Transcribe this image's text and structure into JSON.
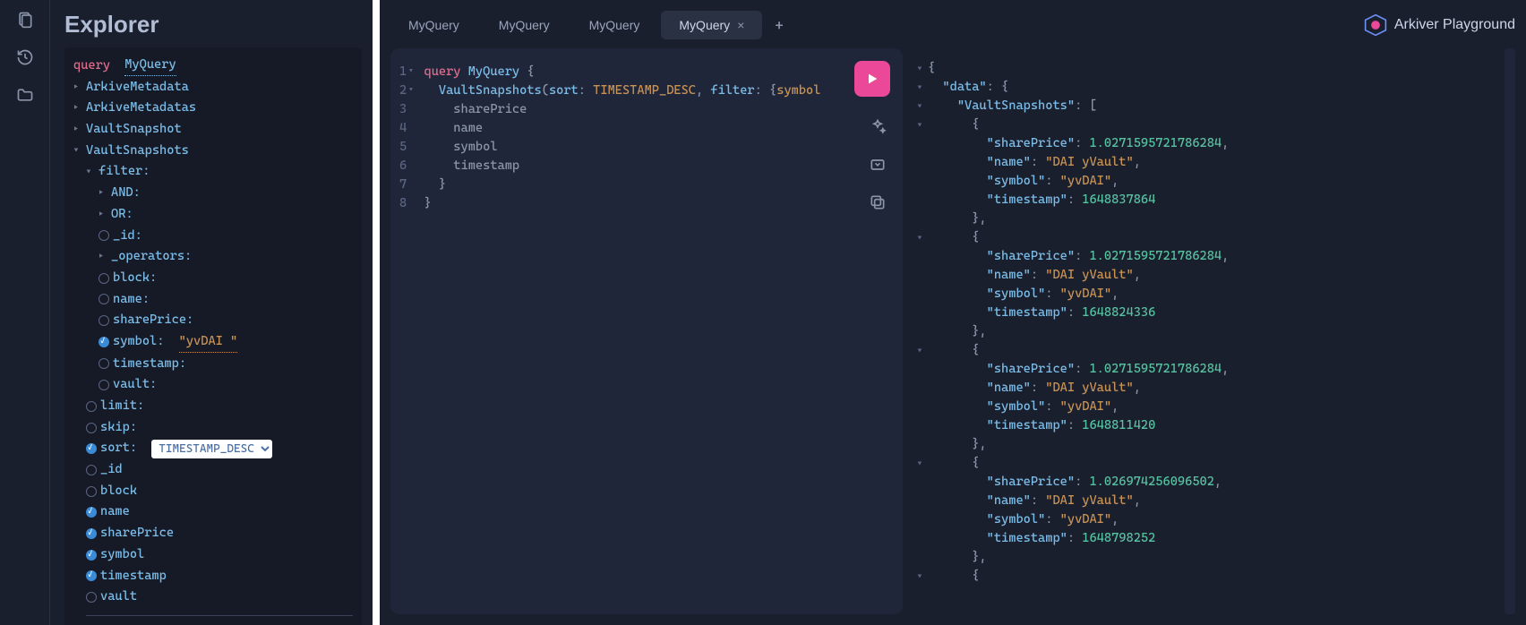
{
  "rail": {
    "icons": [
      "docs-icon",
      "history-icon",
      "folder-icon"
    ]
  },
  "explorer": {
    "title": "Explorer",
    "query_kw": "query",
    "query_name": "MyQuery",
    "types": [
      {
        "name": "ArkiveMetadata",
        "expanded": false
      },
      {
        "name": "ArkiveMetadatas",
        "expanded": false
      },
      {
        "name": "VaultSnapshot",
        "expanded": false
      },
      {
        "name": "VaultSnapshots",
        "expanded": true
      }
    ],
    "vaultSnapshots": {
      "filter": {
        "label": "filter:",
        "children": [
          {
            "kind": "caret",
            "label": "AND:"
          },
          {
            "kind": "caret",
            "label": "OR:"
          },
          {
            "kind": "radio",
            "label": "_id:"
          },
          {
            "kind": "caret",
            "label": "_operators:"
          },
          {
            "kind": "radio",
            "label": "block:"
          },
          {
            "kind": "radio",
            "label": "name:"
          },
          {
            "kind": "radio",
            "label": "sharePrice:"
          },
          {
            "kind": "check",
            "label": "symbol:",
            "value": "\"yvDAI \""
          },
          {
            "kind": "radio",
            "label": "timestamp:"
          },
          {
            "kind": "radio",
            "label": "vault:"
          }
        ]
      },
      "args": [
        {
          "kind": "radio",
          "label": "limit:"
        },
        {
          "kind": "radio",
          "label": "skip:"
        },
        {
          "kind": "check",
          "label": "sort:",
          "select": "TIMESTAMP_DESC"
        }
      ],
      "fields": [
        {
          "kind": "radio",
          "label": "_id"
        },
        {
          "kind": "radio",
          "label": "block"
        },
        {
          "kind": "check",
          "label": "name"
        },
        {
          "kind": "check",
          "label": "sharePrice"
        },
        {
          "kind": "check",
          "label": "symbol"
        },
        {
          "kind": "check",
          "label": "timestamp"
        },
        {
          "kind": "radio",
          "label": "vault"
        }
      ]
    }
  },
  "tabs": {
    "items": [
      "MyQuery",
      "MyQuery",
      "MyQuery",
      "MyQuery"
    ],
    "activeIndex": 3
  },
  "brand": {
    "label": "Arkiver Playground"
  },
  "editor": {
    "lines": [
      {
        "n": 1,
        "fold": true,
        "segs": [
          {
            "t": "query ",
            "c": "c-kw"
          },
          {
            "t": "MyQuery",
            "c": "c-name"
          },
          {
            "t": " {",
            "c": "c-punc"
          }
        ]
      },
      {
        "n": 2,
        "fold": true,
        "segs": [
          {
            "t": "  ",
            "c": ""
          },
          {
            "t": "VaultSnapshots",
            "c": "c-name"
          },
          {
            "t": "(",
            "c": "c-punc"
          },
          {
            "t": "sort",
            "c": "c-arg"
          },
          {
            "t": ": ",
            "c": "c-punc"
          },
          {
            "t": "TIMESTAMP_DESC",
            "c": "c-enum"
          },
          {
            "t": ", ",
            "c": "c-punc"
          },
          {
            "t": "filter",
            "c": "c-arg"
          },
          {
            "t": ": {",
            "c": "c-punc"
          },
          {
            "t": "symbol",
            "c": "c-enum"
          }
        ]
      },
      {
        "n": 3,
        "segs": [
          {
            "t": "    sharePrice",
            "c": "c-field"
          }
        ]
      },
      {
        "n": 4,
        "segs": [
          {
            "t": "    name",
            "c": "c-field"
          }
        ]
      },
      {
        "n": 5,
        "segs": [
          {
            "t": "    symbol",
            "c": "c-field"
          }
        ]
      },
      {
        "n": 6,
        "segs": [
          {
            "t": "    timestamp",
            "c": "c-field"
          }
        ]
      },
      {
        "n": 7,
        "segs": [
          {
            "t": "  }",
            "c": "c-punc"
          }
        ]
      },
      {
        "n": 8,
        "segs": [
          {
            "t": "}",
            "c": "c-punc"
          }
        ]
      }
    ]
  },
  "results": {
    "data_key": "data",
    "collection_key": "VaultSnapshots",
    "items": [
      {
        "sharePrice": "1.0271595721786284",
        "name": "DAI yVault",
        "symbol": "yvDAI",
        "timestamp": "1648837864"
      },
      {
        "sharePrice": "1.0271595721786284",
        "name": "DAI yVault",
        "symbol": "yvDAI",
        "timestamp": "1648824336"
      },
      {
        "sharePrice": "1.0271595721786284",
        "name": "DAI yVault",
        "symbol": "yvDAI",
        "timestamp": "1648811420"
      },
      {
        "sharePrice": "1.026974256096502",
        "name": "DAI yVault",
        "symbol": "yvDAI",
        "timestamp": "1648798252"
      }
    ]
  }
}
